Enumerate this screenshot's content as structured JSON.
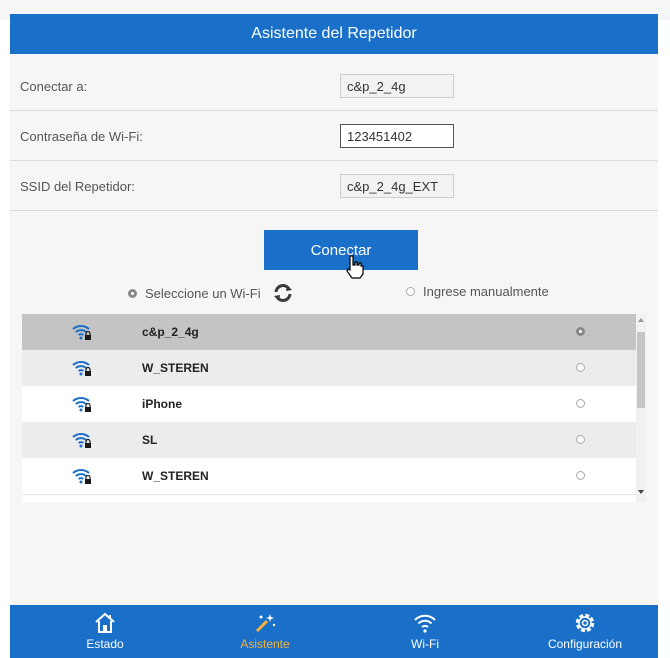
{
  "header": {
    "title": "Asistente del Repetidor"
  },
  "form": {
    "connect_to": {
      "label": "Conectar a:",
      "value": "c&p_2_4g"
    },
    "wifi_password": {
      "label": "Contraseña de Wi-Fi:",
      "value": "123451402"
    },
    "repeater_ssid": {
      "label": "SSID del Repetidor:",
      "value": "c&p_2_4g_EXT"
    }
  },
  "connect_button": {
    "label": "Conectar"
  },
  "mode": {
    "select_wifi": {
      "label": "Seleccione un Wi-Fi",
      "selected": true
    },
    "manual": {
      "label": "Ingrese manualmente",
      "selected": false
    }
  },
  "networks": [
    {
      "ssid": "c&p_2_4g",
      "selected": true,
      "icon": "wifi-locked-icon"
    },
    {
      "ssid": "W_STEREN",
      "selected": false,
      "icon": "wifi-locked-icon"
    },
    {
      "ssid": "iPhone",
      "selected": false,
      "icon": "wifi-locked-icon"
    },
    {
      "ssid": "SL",
      "selected": false,
      "icon": "wifi-locked-icon"
    },
    {
      "ssid": "W_STEREN",
      "selected": false,
      "icon": "wifi-locked-icon"
    }
  ],
  "tabs": [
    {
      "label": "Estado",
      "icon": "home-icon",
      "active": false
    },
    {
      "label": "Asistente",
      "icon": "wand-icon",
      "active": true
    },
    {
      "label": "Wi-Fi",
      "icon": "wifi-icon",
      "active": false
    },
    {
      "label": "Configuración",
      "icon": "gear-icon",
      "active": false
    }
  ],
  "colors": {
    "primary": "#1a70c9",
    "active_tab": "#f6b23a"
  }
}
